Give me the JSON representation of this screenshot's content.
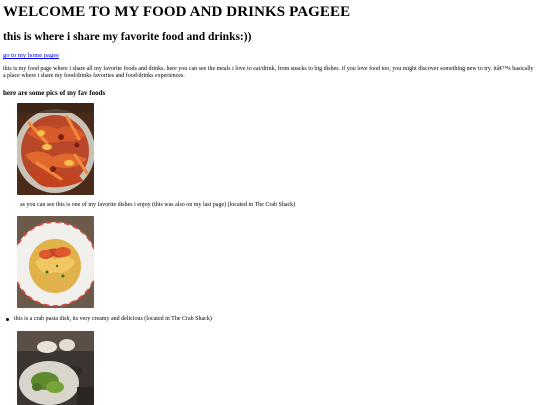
{
  "header": {
    "title": "WELCOME TO MY FOOD AND DRINKS PAGEEE",
    "subtitle": "this is where i share my favorite food and drinks:))"
  },
  "nav": {
    "home_link": "go to my home pagee"
  },
  "intro": {
    "text": "this is my food page where i share all my favorite foods and drinks. here you can see the meals i love to eat/drink, from snacks to big dishes. if you love food too, you might discover something new to try. itâ€™s basically a place where i share my food/drinks favorites and food/drinks experiences."
  },
  "section": {
    "heading": "here are some pics of my fav foods"
  },
  "foods": [
    {
      "caption": "as you can see this is one of my favorite dishes i enjoy (this was also on my last page) (located in The Crab Shack)"
    },
    {
      "caption": "this is a crab pasta dish, its very creamy and delicious (located in The Crab Shack)"
    }
  ],
  "colors": {
    "link": "#0000ee",
    "background": "#ffffff",
    "text": "#000000"
  }
}
